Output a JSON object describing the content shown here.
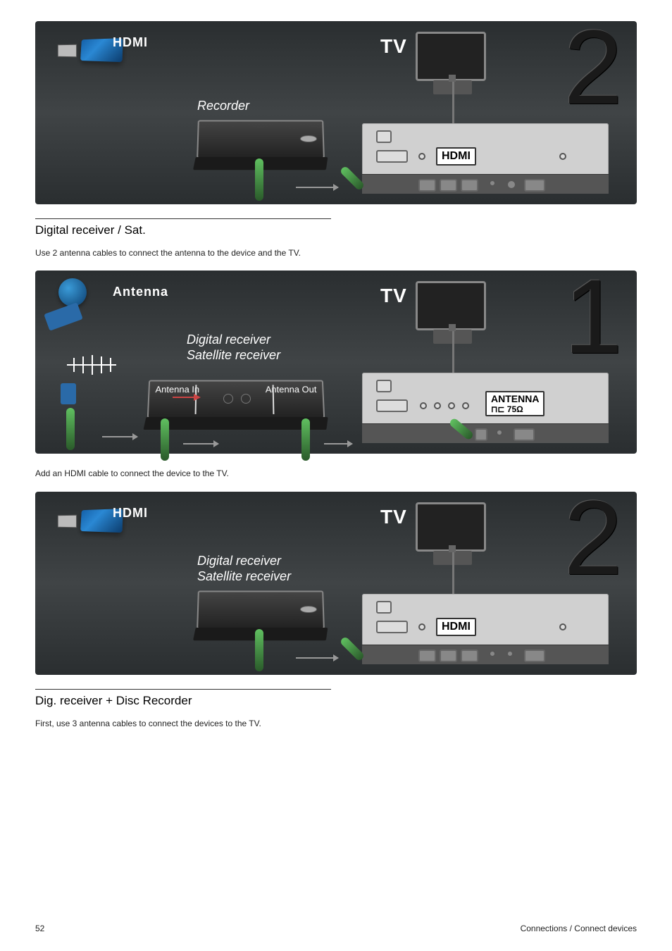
{
  "diagram1": {
    "step_number": "2",
    "connector_label": "HDMI",
    "device_label": "Recorder",
    "tv_label": "TV",
    "port_label": "HDMI"
  },
  "section1": {
    "heading": "Digital receiver / Sat.",
    "text": "Use 2 antenna cables to connect the antenna to the device and the TV."
  },
  "diagram2": {
    "step_number": "1",
    "connector_label": "Antenna",
    "device_label_line1": "Digital receiver",
    "device_label_line2": "Satellite receiver",
    "tv_label": "TV",
    "port_label": "ANTENNA",
    "port_sublabel": "75Ω",
    "device_port_in": "Antenna In",
    "device_port_out": "Antenna Out"
  },
  "caption2": "Add an HDMI cable to connect the device to the TV.",
  "diagram3": {
    "step_number": "2",
    "connector_label": "HDMI",
    "device_label_line1": "Digital receiver",
    "device_label_line2": "Satellite receiver",
    "tv_label": "TV",
    "port_label": "HDMI"
  },
  "section2": {
    "heading": "Dig. receiver + Disc Recorder",
    "text": "First, use 3 antenna cables to connect the devices to the TV."
  },
  "footer": {
    "page": "52",
    "chapter": "Connections / Connect devices"
  }
}
